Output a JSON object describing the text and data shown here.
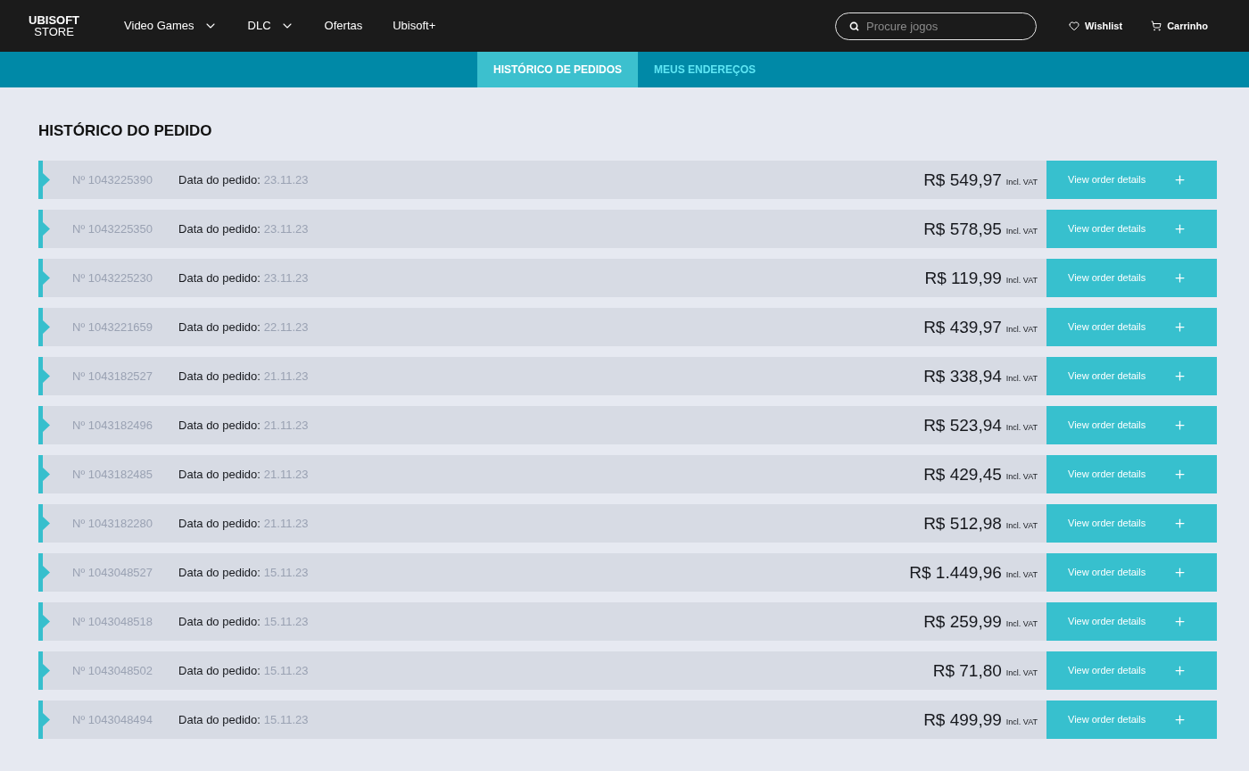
{
  "header": {
    "logo": {
      "line_1": "UBISOFT",
      "line_2": "STORE"
    },
    "nav": [
      {
        "label": "Video Games",
        "kind": "dropdown"
      },
      {
        "label": "DLC",
        "kind": "dropdown"
      },
      {
        "label": "Ofertas",
        "kind": "link"
      },
      {
        "label": "Ubisoft+",
        "kind": "link"
      }
    ],
    "search": {
      "placeholder": "Procure jogos"
    },
    "actions": [
      {
        "label": "Wishlist",
        "kind": "wishlist"
      },
      {
        "label": "Carrinho",
        "kind": "cart"
      }
    ]
  },
  "account_tabs": [
    {
      "label": "HISTÓRICO DE PEDIDOS",
      "selected": true
    },
    {
      "label": "MEUS ENDEREÇOS",
      "selected": false
    }
  ],
  "orders": {
    "title": "HISTÓRICO DO PEDIDO",
    "rows": [
      {
        "number": "Nº 1043225390",
        "date_label": "Data do pedido:",
        "date": "23.11.23",
        "price": "R$ 549,97",
        "tax_note": "Incl. VAT",
        "button": "View order details"
      },
      {
        "number": "Nº 1043225350",
        "date_label": "Data do pedido:",
        "date": "23.11.23",
        "price": "R$ 578,95",
        "tax_note": "Incl. VAT",
        "button": "View order details"
      },
      {
        "number": "Nº 1043225230",
        "date_label": "Data do pedido:",
        "date": "23.11.23",
        "price": "R$ 119,99",
        "tax_note": "Incl. VAT",
        "button": "View order details"
      },
      {
        "number": "Nº 1043221659",
        "date_label": "Data do pedido:",
        "date": "22.11.23",
        "price": "R$ 439,97",
        "tax_note": "Incl. VAT",
        "button": "View order details"
      },
      {
        "number": "Nº 1043182527",
        "date_label": "Data do pedido:",
        "date": "21.11.23",
        "price": "R$ 338,94",
        "tax_note": "Incl. VAT",
        "button": "View order details"
      },
      {
        "number": "Nº 1043182496",
        "date_label": "Data do pedido:",
        "date": "21.11.23",
        "price": "R$ 523,94",
        "tax_note": "Incl. VAT",
        "button": "View order details"
      },
      {
        "number": "Nº 1043182485",
        "date_label": "Data do pedido:",
        "date": "21.11.23",
        "price": "R$ 429,45",
        "tax_note": "Incl. VAT",
        "button": "View order details"
      },
      {
        "number": "Nº 1043182280",
        "date_label": "Data do pedido:",
        "date": "21.11.23",
        "price": "R$ 512,98",
        "tax_note": "Incl. VAT",
        "button": "View order details"
      },
      {
        "number": "Nº 1043048527",
        "date_label": "Data do pedido:",
        "date": "15.11.23",
        "price": "R$ 1.449,96",
        "tax_note": "Incl. VAT",
        "button": "View order details"
      },
      {
        "number": "Nº 1043048518",
        "date_label": "Data do pedido:",
        "date": "15.11.23",
        "price": "R$ 259,99",
        "tax_note": "Incl. VAT",
        "button": "View order details"
      },
      {
        "number": "Nº 1043048502",
        "date_label": "Data do pedido:",
        "date": "15.11.23",
        "price": "R$ 71,80",
        "tax_note": "Incl. VAT",
        "button": "View order details"
      },
      {
        "number": "Nº 1043048494",
        "date_label": "Data do pedido:",
        "date": "15.11.23",
        "price": "R$ 499,99",
        "tax_note": "Incl. VAT",
        "button": "View order details"
      }
    ]
  }
}
